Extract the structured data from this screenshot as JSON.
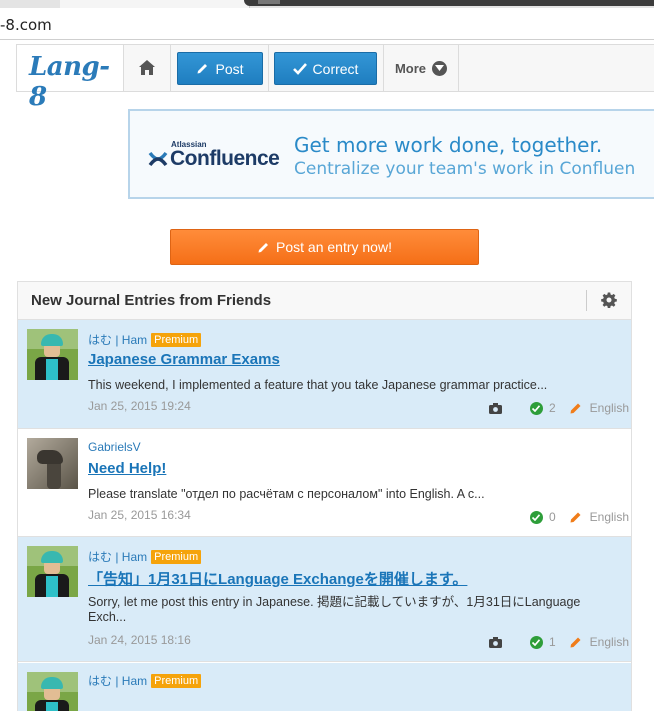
{
  "browser": {
    "url": "-8.com"
  },
  "header": {
    "logo": "Lang-8",
    "post_label": "Post",
    "correct_label": "Correct",
    "more_label": "More"
  },
  "ad": {
    "brand_small": "Atlassian",
    "brand": "Confluence",
    "line1": "Get more work done, together.",
    "line2": "Centralize your team's work in Confluen"
  },
  "post_entry_label": "Post an entry now!",
  "journal": {
    "title": "New Journal Entries from Friends",
    "entries": [
      {
        "user": "はむ | Ham",
        "premium": "Premium",
        "title": "Japanese Grammar Exams",
        "body": "This weekend, I implemented a feature that you take Japanese grammar practice...",
        "date": "Jan 25, 2015 19:24",
        "corrections": "2",
        "language": "English",
        "has_photo": true,
        "highlighted": true
      },
      {
        "user": "GabrielsV",
        "premium": "",
        "title": "Need Help!",
        "body": "Please translate \"отдел по расчётам с персоналом\" into English. A c...",
        "date": "Jan 25, 2015 16:34",
        "corrections": "0",
        "language": "English",
        "has_photo": false,
        "highlighted": false
      },
      {
        "user": "はむ | Ham",
        "premium": "Premium",
        "title": "「告知」1月31日にLanguage Exchangeを開催します。",
        "body": "Sorry, let me post this entry in Japanese. 掲題に記載していますが、1月31日にLanguage Exch...",
        "date": "Jan 24, 2015 18:16",
        "corrections": "1",
        "language": "English",
        "has_photo": true,
        "highlighted": true
      },
      {
        "user": "はむ | Ham",
        "premium": "Premium",
        "highlighted": true
      }
    ]
  },
  "colors": {
    "brand_blue": "#2b7bb9",
    "button_blue": "#1f7ec0",
    "orange": "#f56f17",
    "highlight_row": "#d9ebf8",
    "premium": "#f5a30b",
    "check_green": "#2e9e3a"
  }
}
